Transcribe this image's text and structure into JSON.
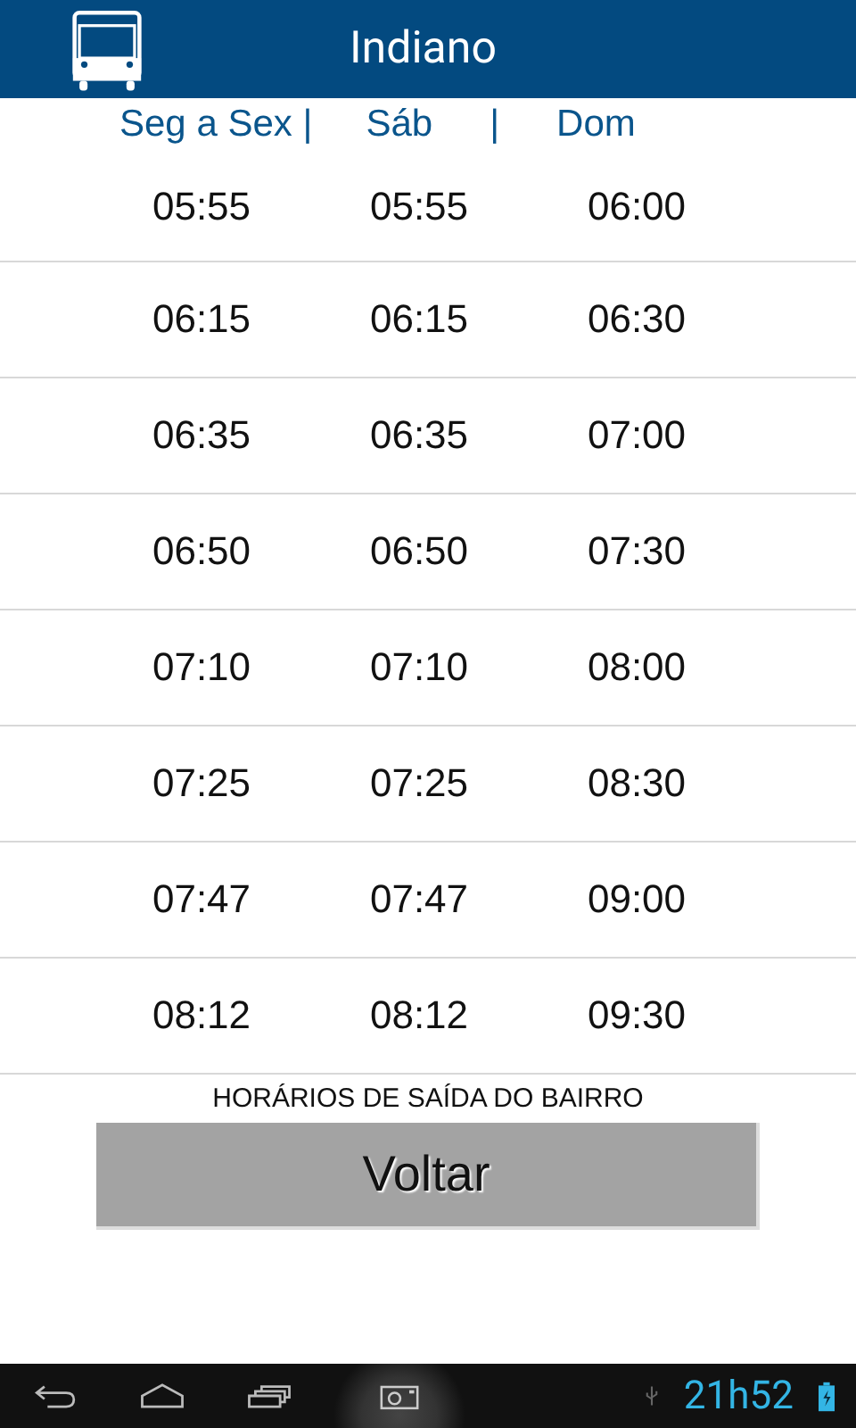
{
  "app_bar": {
    "title": "Indiano"
  },
  "column_headers": [
    "Seg a Sex |",
    "Sáb",
    "|",
    "Dom"
  ],
  "rows": [
    [
      "05:55",
      "05:55",
      "06:00"
    ],
    [
      "06:15",
      "06:15",
      "06:30"
    ],
    [
      "06:35",
      "06:35",
      "07:00"
    ],
    [
      "06:50",
      "06:50",
      "07:30"
    ],
    [
      "07:10",
      "07:10",
      "08:00"
    ],
    [
      "07:25",
      "07:25",
      "08:30"
    ],
    [
      "07:47",
      "07:47",
      "09:00"
    ],
    [
      "08:12",
      "08:12",
      "09:30"
    ]
  ],
  "caption": "HORÁRIOS DE SAÍDA DO BAIRRO",
  "back_button": "Voltar",
  "status_bar": {
    "time": "21h52"
  }
}
